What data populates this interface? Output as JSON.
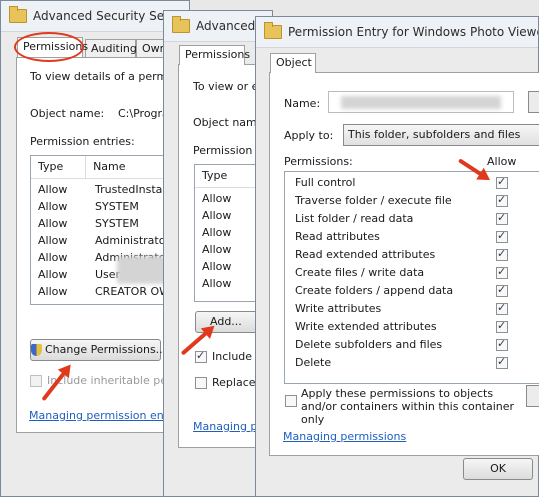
{
  "win1": {
    "title": "Advanced Security Settings",
    "tabs": [
      "Permissions",
      "Auditing",
      "Owner"
    ],
    "intro": "To view details of a permission",
    "object_name_label": "Object name:",
    "object_name_value": "C:\\Program",
    "entries_label": "Permission entries:",
    "columns": [
      "Type",
      "Name"
    ],
    "rows": [
      {
        "type": "Allow",
        "name": "TrustedInstaller"
      },
      {
        "type": "Allow",
        "name": "SYSTEM"
      },
      {
        "type": "Allow",
        "name": "SYSTEM"
      },
      {
        "type": "Allow",
        "name": "Administrators ("
      },
      {
        "type": "Allow",
        "name": "Administrators"
      },
      {
        "type": "Allow",
        "name": "Users"
      },
      {
        "type": "Allow",
        "name": "CREATOR OWN"
      }
    ],
    "change_button": "Change Permissions...",
    "include_label": "Include inheritable permiss",
    "link": "Managing permission entries"
  },
  "win2": {
    "title": "Advanced S",
    "tab": "Permissions",
    "intro": "To view or e",
    "object_name_label": "Object name",
    "entries_label": "Permission en",
    "column": "Type",
    "rows": [
      "Allow",
      "Allow",
      "Allow",
      "Allow",
      "Allow",
      "Allow"
    ],
    "add_button": "Add...",
    "include_label": "Include in",
    "replace_label": "Replace a",
    "link": "Managing p"
  },
  "win3": {
    "title": "Permission Entry for Windows Photo Viewer - Co",
    "tab": "Object",
    "name_label": "Name:",
    "apply_label": "Apply to:",
    "apply_value": "This folder, subfolders and files",
    "permissions_label": "Permissions:",
    "allow_label": "Allow",
    "permissions": [
      "Full control",
      "Traverse folder / execute file",
      "List folder / read data",
      "Read attributes",
      "Read extended attributes",
      "Create files / write data",
      "Create folders / append data",
      "Write attributes",
      "Write extended attributes",
      "Delete subfolders and files",
      "Delete"
    ],
    "apply_objects_label": "Apply these permissions to objects and/or containers within this container only",
    "link": "Managing permissions",
    "ok_button": "OK"
  },
  "colors": {
    "annotation": "#e03a1e",
    "link": "#1f5fbf"
  }
}
